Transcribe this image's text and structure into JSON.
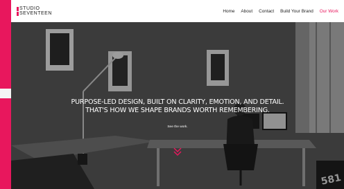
{
  "brand": {
    "logo_line1": "STUDIO",
    "logo_line2": "SEVENTEEN",
    "accent_color": "#e8175d"
  },
  "nav": {
    "items": [
      {
        "label": "Home"
      },
      {
        "label": "About"
      },
      {
        "label": "Contact"
      },
      {
        "label": "Build Your Brand"
      },
      {
        "label": "Our Work"
      }
    ],
    "active_item": "Our Work"
  },
  "hero": {
    "headline_line1": "PURPOSE-LED DESIGN, BUILT ON CLARITY, EMOTION, AND DETAIL.",
    "headline_line2": "THAT'S HOW WE SHAPE BRANDS WORTH REMEMBERING.",
    "cta_label": "See the work.",
    "scroll_icon": "double-chevron-down-icon"
  }
}
